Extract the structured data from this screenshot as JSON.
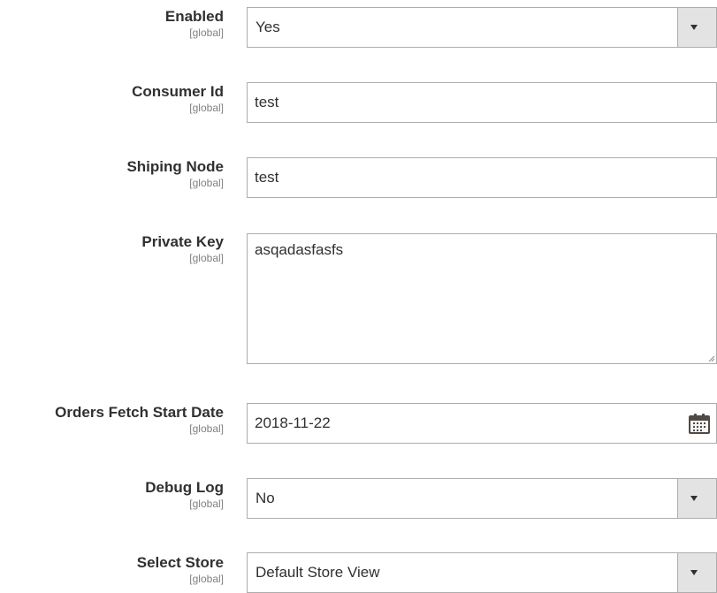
{
  "fields": {
    "enabled": {
      "label": "Enabled",
      "scope": "[global]",
      "value": "Yes"
    },
    "consumer_id": {
      "label": "Consumer Id",
      "scope": "[global]",
      "value": "test"
    },
    "shipping_node": {
      "label": "Shiping Node",
      "scope": "[global]",
      "value": "test"
    },
    "private_key": {
      "label": "Private Key",
      "scope": "[global]",
      "value": "asqadasfasfs"
    },
    "orders_fetch_start_date": {
      "label": "Orders Fetch Start Date",
      "scope": "[global]",
      "value": "2018-11-22"
    },
    "debug_log": {
      "label": "Debug Log",
      "scope": "[global]",
      "value": "No"
    },
    "select_store": {
      "label": "Select Store",
      "scope": "[global]",
      "value": "Default Store View"
    }
  },
  "icons": {
    "select_arrow": "chevron-down-icon",
    "date_picker": "calendar-icon",
    "resize": "resize-handle-icon"
  },
  "colors": {
    "label": "#303030",
    "scope": "#808080",
    "border": "#adadad",
    "select_button": "#e3e3e3"
  }
}
